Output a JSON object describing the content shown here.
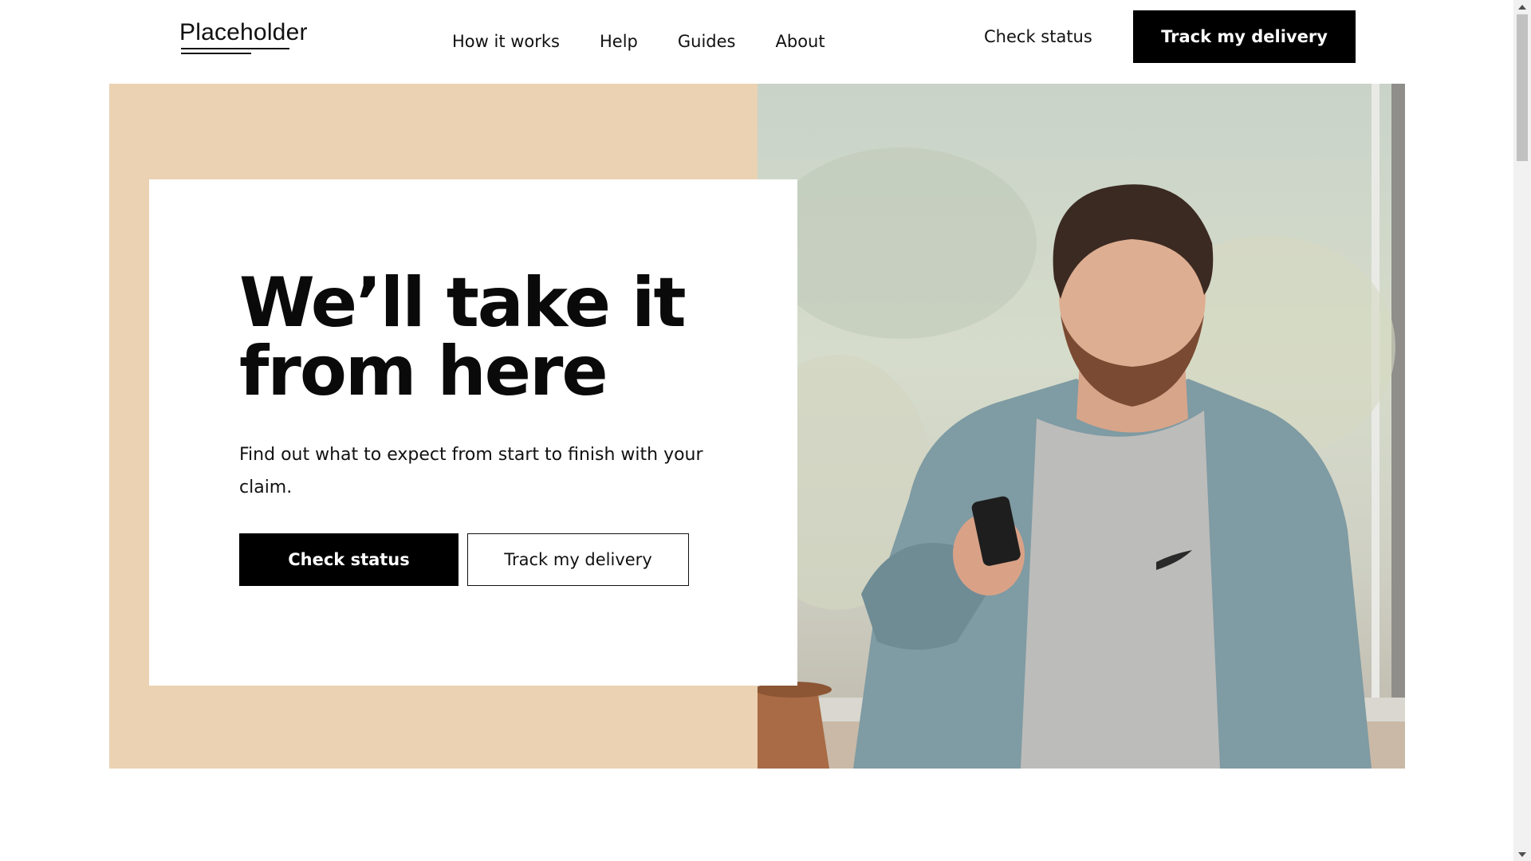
{
  "header": {
    "logo_text": "Placeholder",
    "nav": [
      {
        "label": "How it works"
      },
      {
        "label": "Help"
      },
      {
        "label": "Guides"
      },
      {
        "label": "About"
      }
    ],
    "check_status_label": "Check status",
    "track_button_label": "Track my delivery"
  },
  "hero": {
    "title": "We’ll take it from here",
    "subtitle": "Find out what to expect from start to finish with your claim.",
    "primary_button_label": "Check status",
    "secondary_button_label": "Track my delivery",
    "panel_color": "#ebd2b3",
    "image_subject": "man-looking-at-phone-photo"
  },
  "colors": {
    "primary": "#000000",
    "background": "#ffffff",
    "accent": "#ebd2b3"
  }
}
